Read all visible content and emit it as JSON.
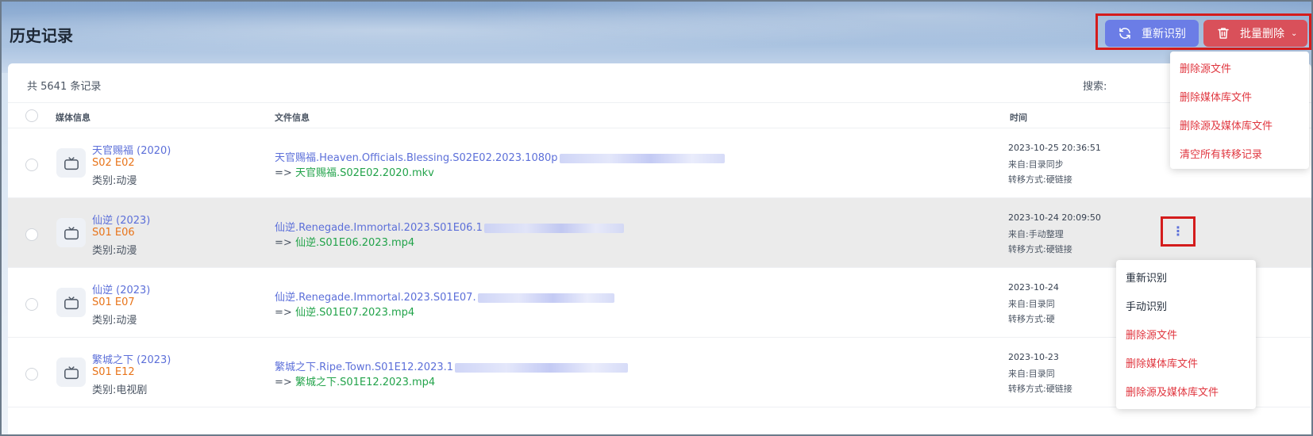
{
  "page": {
    "title": "历史记录"
  },
  "toolbar": {
    "reidentify_label": "重新识别",
    "batch_delete_label": "批量删除",
    "batch_delete_menu": [
      "删除源文件",
      "删除媒体库文件",
      "删除源及媒体库文件",
      "清空所有转移记录"
    ]
  },
  "summary": {
    "total_text": "共 5641 条记录",
    "search_label": "搜索:"
  },
  "table": {
    "headers": {
      "media": "媒体信息",
      "file": "文件信息",
      "time": "时间"
    },
    "rows": [
      {
        "title": "天官赐福 (2020)",
        "episode": "S02 E02",
        "category": "类别:动漫",
        "src": "天官赐福.Heaven.Officials.Blessing.S02E02.2023.1080p",
        "dst_arrow": "=>",
        "dst": "天官赐福.S02E02.2020.mkv",
        "time": "2023-10-25 20:36:51",
        "from": "来自:目录同步",
        "method": "转移方式:硬链接"
      },
      {
        "title": "仙逆 (2023)",
        "episode": "S01 E06",
        "category": "类别:动漫",
        "src": "仙逆.Renegade.Immortal.2023.S01E06.1",
        "dst_arrow": "=>",
        "dst": "仙逆.S01E06.2023.mp4",
        "time": "2023-10-24 20:09:50",
        "from": "来自:手动整理",
        "method": "转移方式:硬链接"
      },
      {
        "title": "仙逆 (2023)",
        "episode": "S01 E07",
        "category": "类别:动漫",
        "src": "仙逆.Renegade.Immortal.2023.S01E07.",
        "dst_arrow": "=>",
        "dst": "仙逆.S01E07.2023.mp4",
        "time": "2023-10-24",
        "from": "来自:目录同",
        "method": "转移方式:硬"
      },
      {
        "title": "繁城之下 (2023)",
        "episode": "S01 E12",
        "category": "类别:电视剧",
        "src": "繁城之下.Ripe.Town.S01E12.2023.1",
        "dst_arrow": "=>",
        "dst": "繁城之下.S01E12.2023.mp4",
        "time": "2023-10-23",
        "from": "来自:目录同",
        "method": "转移方式:硬链接"
      }
    ]
  },
  "row_menu": [
    "重新识别",
    "手动识别",
    "删除源文件",
    "删除媒体库文件",
    "删除源及媒体库文件"
  ],
  "icons": {
    "reidentify": "refresh-icon",
    "delete": "trash-icon",
    "media": "tv-icon",
    "more": "more-vertical-icon"
  },
  "colors": {
    "primary": "#6b7de6",
    "danger": "#d9505a",
    "highlight_border": "#d41c1c",
    "dest_green": "#22a34a",
    "episode_orange": "#e8741a"
  }
}
